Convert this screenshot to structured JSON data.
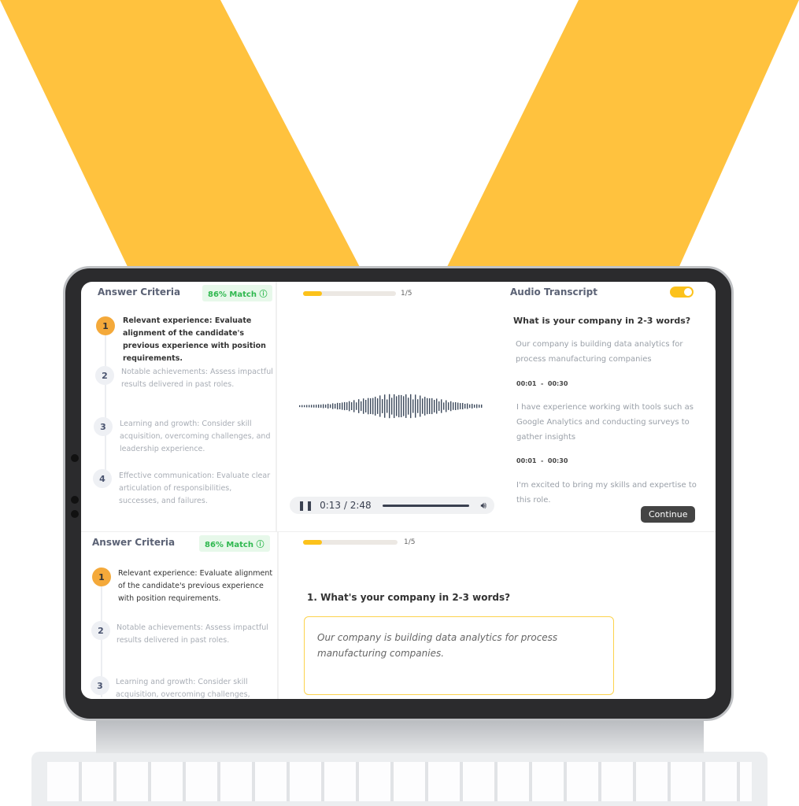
{
  "colors": {
    "accent": "#FFC23E",
    "progress": "#FCC21B",
    "match_green": "#2FB84F",
    "active_step": "#F4A93A"
  },
  "top_panel": {
    "criteria_title": "Answer Criteria",
    "match_badge": "86% Match",
    "info_icon": "info-icon",
    "criteria": [
      {
        "num": "1",
        "text": "Relevant experience: Evaluate alignment of the candidate's previous experience with position requirements.",
        "active": true
      },
      {
        "num": "2",
        "text": "Notable achievements: Assess impactful results delivered in past roles.",
        "active": false
      },
      {
        "num": "3",
        "text": "Learning and growth: Consider skill acquisition, overcoming challenges, and leadership experience.",
        "active": false
      },
      {
        "num": "4",
        "text": "Effective communication: Evaluate clear articulation of responsibilities, successes, and failures.",
        "active": false
      }
    ],
    "progress_label": "1/5",
    "progress_fraction": 0.2,
    "player": {
      "time": "0:13 / 2:48",
      "pause_icon": "pause-icon",
      "volume_icon": "volume-icon",
      "position_fraction": 0.08
    },
    "transcript": {
      "title": "Audio Transcript",
      "toggle_on": true,
      "question": "What is your company in 2-3 words?",
      "entries": [
        {
          "text": "Our company is building data analytics for process manufacturing companies",
          "time": "00:01  -  00:30"
        },
        {
          "text": "I have experience working with tools such as Google Analytics and conducting surveys to gather insights",
          "time": "00:01  -  00:30"
        },
        {
          "text": "I'm excited to bring my skills and expertise to this role.",
          "time": ""
        }
      ],
      "continue_label": "Continue"
    }
  },
  "bottom_panel": {
    "criteria_title": "Answer Criteria",
    "match_badge": "86% Match",
    "criteria": [
      {
        "num": "1",
        "text": "Relevant experience: Evaluate alignment of the candidate's previous experience with position requirements."
      },
      {
        "num": "2",
        "text": "Notable achievements: Assess impactful results delivered in past roles."
      },
      {
        "num": "3",
        "text": "Learning and growth: Consider skill acquisition, overcoming challenges,"
      }
    ],
    "progress_label": "1/5",
    "progress_fraction": 0.2,
    "question": "1. What's your company in 2-3 words?",
    "answer": "Our company is building data analytics for process manufacturing companies."
  }
}
